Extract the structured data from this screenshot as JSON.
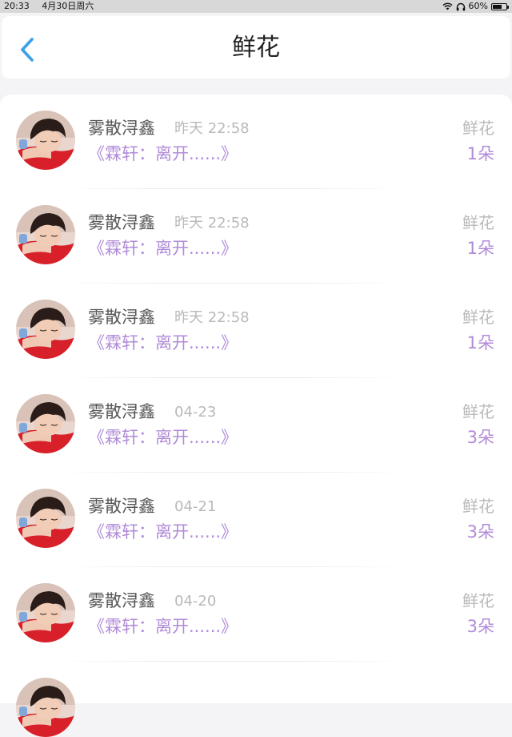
{
  "status_bar": {
    "time": "20:33",
    "date": "4月30日周六",
    "battery": "60%",
    "battery_level": 0.6,
    "icons": [
      "wifi-icon",
      "headphones-icon",
      "battery-icon"
    ]
  },
  "header": {
    "title": "鲜花",
    "back_icon": "chevron-left-icon"
  },
  "colors": {
    "accent_blue": "#3aa0e8",
    "purple_text": "#b08bd8",
    "gray_text": "#b9b9b9",
    "name_text": "#555555"
  },
  "items": [
    {
      "name": "雾散浔鑫",
      "time": "昨天 22:58",
      "message": "《霖轩：离开......》",
      "gift": "鲜花",
      "count": "1朵"
    },
    {
      "name": "雾散浔鑫",
      "time": "昨天 22:58",
      "message": "《霖轩：离开......》",
      "gift": "鲜花",
      "count": "1朵"
    },
    {
      "name": "雾散浔鑫",
      "time": "昨天 22:58",
      "message": "《霖轩：离开......》",
      "gift": "鲜花",
      "count": "1朵"
    },
    {
      "name": "雾散浔鑫",
      "time": "04-23",
      "message": "《霖轩：离开......》",
      "gift": "鲜花",
      "count": "3朵"
    },
    {
      "name": "雾散浔鑫",
      "time": "04-21",
      "message": "《霖轩：离开......》",
      "gift": "鲜花",
      "count": "3朵"
    },
    {
      "name": "雾散浔鑫",
      "time": "04-20",
      "message": "《霖轩：离开......》",
      "gift": "鲜花",
      "count": "3朵"
    }
  ]
}
